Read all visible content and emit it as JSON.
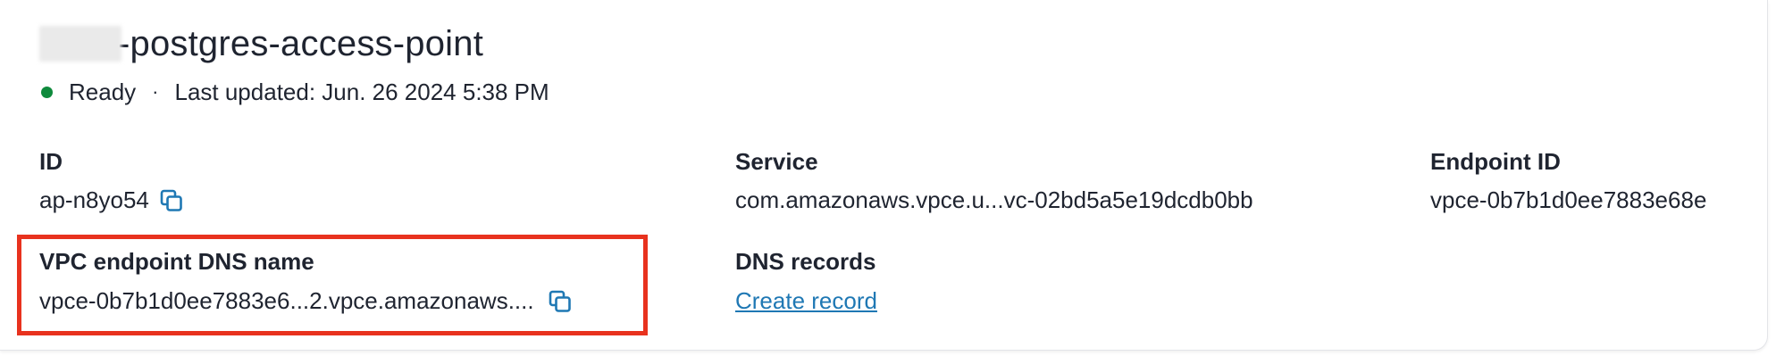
{
  "access_point": {
    "title": "-postgres-access-point",
    "status": "Ready",
    "status_color": "#0f8a3c",
    "separator": "·",
    "last_updated": "Last updated: Jun. 26 2024 5:38 PM"
  },
  "fields": {
    "id_label": "ID",
    "id_value": "ap-n8yo54",
    "service_label": "Service",
    "service_value": "com.amazonaws.vpce.u...vc-02bd5a5e19dcdb0bb",
    "endpoint_id_label": "Endpoint ID",
    "endpoint_id_value": "vpce-0b7b1d0ee7883e68e",
    "vpc_dns_label": "VPC endpoint DNS name",
    "vpc_dns_value": "vpce-0b7b1d0ee7883e6...2.vpce.amazonaws....",
    "dns_records_label": "DNS records",
    "dns_records_link": "Create record"
  },
  "icons": {
    "copy": "copy-icon",
    "status": "status-dot"
  },
  "colors": {
    "link": "#1f78b4",
    "highlight_border": "#e8321e"
  }
}
